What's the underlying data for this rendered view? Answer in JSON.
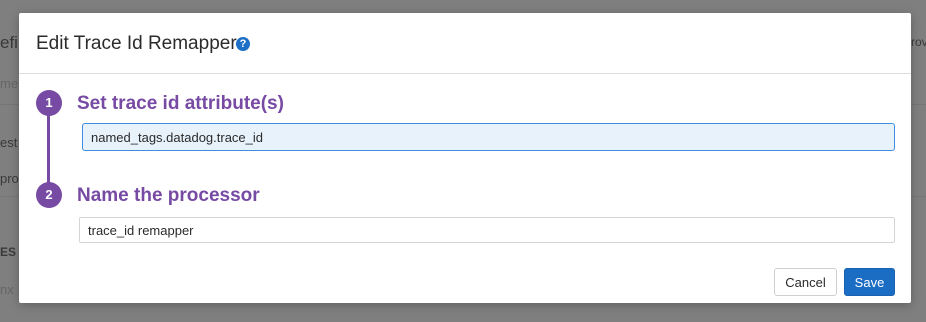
{
  "background": {
    "fragments": [
      "efi",
      "mes",
      "est",
      "pro",
      "ES",
      "nx",
      "rov"
    ]
  },
  "modal": {
    "title": "Edit Trace Id Remapper",
    "help_icon": "?",
    "steps": [
      {
        "number": "1",
        "title": "Set trace id attribute(s)",
        "value": "named_tags.datadog.trace_id"
      },
      {
        "number": "2",
        "title": "Name the processor",
        "value": "trace_id remapper"
      }
    ],
    "buttons": {
      "cancel": "Cancel",
      "save": "Save"
    }
  },
  "colors": {
    "accent_purple": "#774aa4",
    "primary_blue": "#1b6cc3",
    "focus_border": "#3e8ede"
  }
}
